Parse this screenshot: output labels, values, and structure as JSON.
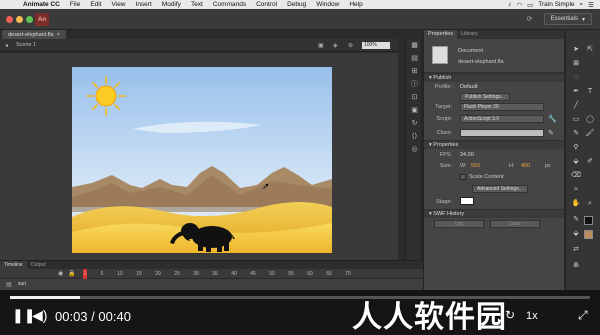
{
  "menubar": {
    "app_name": "Animate CC",
    "items": [
      "File",
      "Edit",
      "View",
      "Insert",
      "Modify",
      "Text",
      "Commands",
      "Control",
      "Debug",
      "Window",
      "Help"
    ],
    "right_label": "Train Simple"
  },
  "appbar": {
    "logo_text": "An",
    "workspace_label": "Essentials",
    "traffic_colors": [
      "#ee5f57",
      "#f5bd4f",
      "#61c454"
    ]
  },
  "document": {
    "tab_name": "desert-elephant.fla",
    "scene_label": "Scene 1",
    "zoom": "100%"
  },
  "properties": {
    "tabs": [
      "Properties",
      "Library"
    ],
    "doc_type": "Document",
    "doc_name": "desert-elephant.fla",
    "publish": {
      "header": "Publish",
      "profile_label": "Profile:",
      "profile_value": "Default",
      "publish_settings_button": "Publish Settings...",
      "target_label": "Target:",
      "target_value": "Flash Player 20",
      "script_label": "Script:",
      "script_value": "ActionScript 3.0",
      "class_label": "Class:"
    },
    "props": {
      "header": "Properties",
      "fps_label": "FPS:",
      "fps_value": "24.00",
      "size_label": "Size:",
      "w_label": "W:",
      "w_value": "550",
      "h_label": "H:",
      "h_value": "400",
      "unit": "px",
      "scale_content_label": "Scale Content",
      "advanced_button": "Advanced Settings...",
      "stage_label": "Stage:"
    },
    "swf_history": {
      "header": "SWF History",
      "log_button": "Log",
      "clear_button": "Clear"
    }
  },
  "timeline": {
    "tabs": [
      "Timeline",
      "Output"
    ],
    "ticks": [
      "1",
      "5",
      "10",
      "15",
      "20",
      "25",
      "30",
      "35",
      "40",
      "45",
      "50",
      "55",
      "60",
      "65",
      "70"
    ],
    "layer_name": "sun"
  },
  "player": {
    "current_time": "00:03",
    "separator": "/",
    "total_time": "00:40",
    "progress": 0.12,
    "watermark": "人人软件园",
    "speed_label": "1x"
  },
  "colors": {
    "accent_orange": "#f0a040",
    "playhead": "#dd3333",
    "sky_top": "#9cc2ea",
    "sky_bottom": "#dbeaf7",
    "sand": "#f2c23b"
  }
}
